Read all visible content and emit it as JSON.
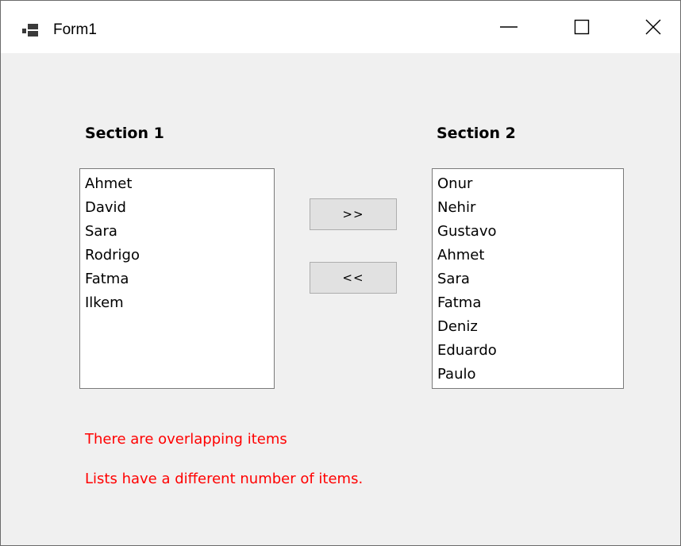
{
  "window": {
    "title": "Form1",
    "controls": {
      "minimize_icon": "minimize-icon",
      "maximize_icon": "maximize-icon",
      "close_icon": "close-icon"
    }
  },
  "section1": {
    "label": "Section 1",
    "items": [
      "Ahmet",
      "David",
      "Sara",
      "Rodrigo",
      "Fatma",
      "Ilkem"
    ]
  },
  "section2": {
    "label": "Section 2",
    "items": [
      "Onur",
      "Nehir",
      "Gustavo",
      "Ahmet",
      "Sara",
      "Fatma",
      "Deniz",
      "Eduardo",
      "Paulo"
    ]
  },
  "buttons": {
    "move_right": ">>",
    "move_left": "<<"
  },
  "messages": {
    "overlap": "There are overlapping items",
    "count": "Lists have a different number of items."
  },
  "colors": {
    "error": "#ff0000",
    "client_bg": "#f0f0f0",
    "button_bg": "#e1e1e1"
  }
}
